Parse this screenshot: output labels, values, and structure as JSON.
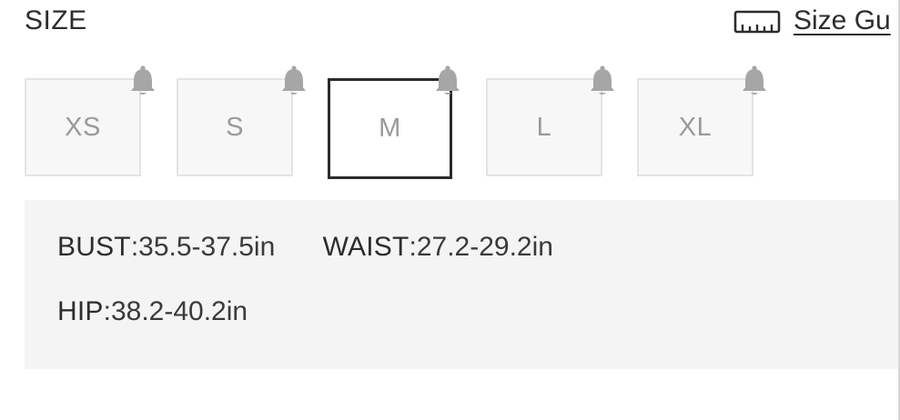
{
  "header": {
    "title": "SIZE",
    "size_guide_label": "Size Gu",
    "size_guide_icon": "ruler-icon"
  },
  "sizes": [
    {
      "label": "XS",
      "selected": false,
      "notify_icon": "bell-icon"
    },
    {
      "label": "S",
      "selected": false,
      "notify_icon": "bell-icon"
    },
    {
      "label": "M",
      "selected": true,
      "notify_icon": "bell-icon"
    },
    {
      "label": "L",
      "selected": false,
      "notify_icon": "bell-icon"
    },
    {
      "label": "XL",
      "selected": false,
      "notify_icon": "bell-icon"
    }
  ],
  "measurements": {
    "bust": {
      "label": "BUST",
      "value": ":35.5-37.5in"
    },
    "waist": {
      "label": "WAIST",
      "value": ":27.2-29.2in"
    },
    "hip": {
      "label": "HIP",
      "value": ":38.2-40.2in"
    }
  },
  "colors": {
    "text": "#2d2d2d",
    "option_text": "#9a9a9a",
    "option_border": "#e4e4e4",
    "option_bg": "#f7f7f7",
    "selected_border": "#2b2b2b",
    "bell": "#a6a6a6",
    "measure_bg": "#f4f4f4"
  }
}
